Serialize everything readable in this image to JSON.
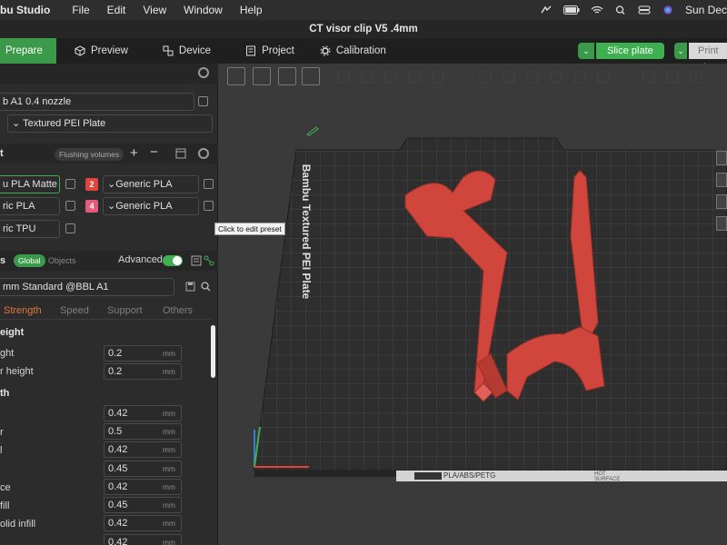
{
  "menubar": {
    "app_name": "bu Studio",
    "items": [
      "File",
      "Edit",
      "View",
      "Window",
      "Help"
    ],
    "clock": "Sun Dec"
  },
  "window": {
    "title": "CT visor clip V5 .4mm"
  },
  "tabs": [
    {
      "label": "Prepare",
      "active": true
    },
    {
      "label": "Preview"
    },
    {
      "label": "Device"
    },
    {
      "label": "Project"
    },
    {
      "label": "Calibration"
    }
  ],
  "actions": {
    "slice_label": "Slice plate",
    "print_label": "Print pl"
  },
  "printer": {
    "model": "b A1 0.4 nozzle",
    "plate": "Textured PEI Plate"
  },
  "filament": {
    "header_label": "t",
    "flushing_label": "Flushing volumes",
    "slots": [
      {
        "label": "u PLA Matte",
        "num": ""
      },
      {
        "label": "Generic PLA",
        "num": "2",
        "color": "#e0443e"
      },
      {
        "label": "ric PLA",
        "num": ""
      },
      {
        "label": "Generic PLA",
        "num": "4",
        "color": "#e35a7a"
      },
      {
        "label": "ric TPU",
        "num": ""
      }
    ]
  },
  "process": {
    "header_label": "s",
    "global_label": "Global",
    "objects_label": "Objects",
    "advanced_label": "Advanced",
    "preset": "mm Standard @BBL A1",
    "subtabs": [
      "Strength",
      "Speed",
      "Support",
      "Others"
    ],
    "active_subtab": "Strength",
    "sections": [
      {
        "title": "eight",
        "params": [
          {
            "label": "ght",
            "value": "0.2",
            "unit": "mm"
          },
          {
            "label": "r height",
            "value": "0.2",
            "unit": "mm"
          }
        ]
      },
      {
        "title": "th",
        "params": [
          {
            "label": "",
            "value": "0.42",
            "unit": "mm"
          },
          {
            "label": "r",
            "value": "0.5",
            "unit": "mm"
          },
          {
            "label": "l",
            "value": "0.42",
            "unit": "mm"
          },
          {
            "label": "",
            "value": "0.45",
            "unit": "mm"
          },
          {
            "label": "ce",
            "value": "0.42",
            "unit": "mm"
          },
          {
            "label": "fill",
            "value": "0.45",
            "unit": "mm"
          },
          {
            "label": "olid infill",
            "value": "0.42",
            "unit": "mm"
          },
          {
            "label": "",
            "value": "0.42",
            "unit": "mm"
          }
        ]
      }
    ]
  },
  "tooltip": "Click to edit preset",
  "plate": {
    "brand_text": "Bambu Textured PEI Plate",
    "footer_text": "PLA/ABS/PETG",
    "hot_surface": "HOT SURFACE",
    "part_color": "#d0463d"
  }
}
